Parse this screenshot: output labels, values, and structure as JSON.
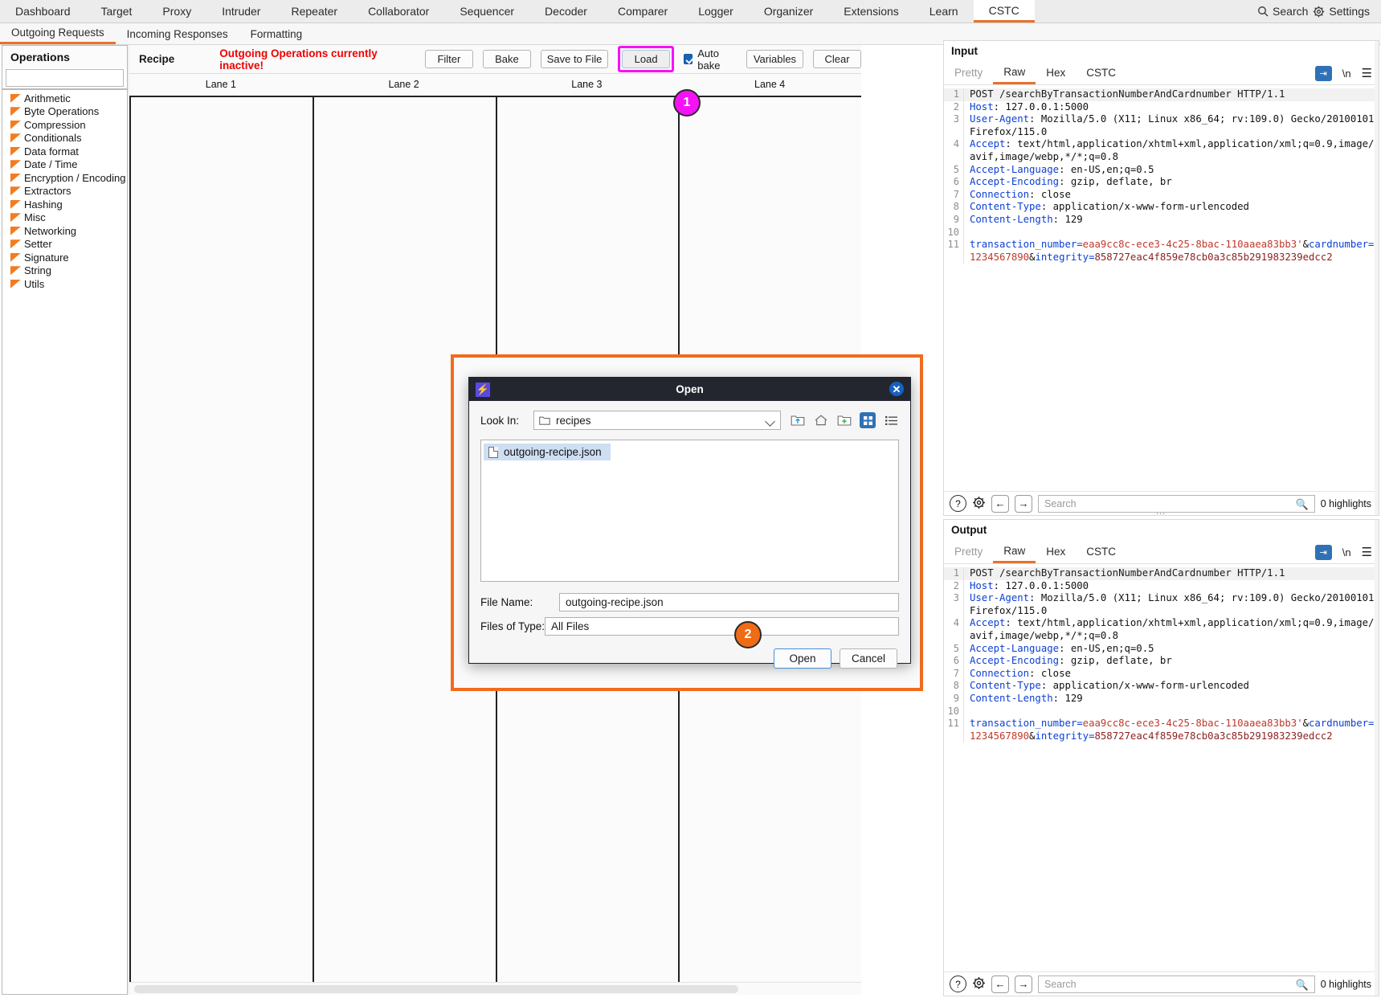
{
  "topnav": {
    "tabs": [
      {
        "label": "Dashboard",
        "active": false
      },
      {
        "label": "Target",
        "active": false
      },
      {
        "label": "Proxy",
        "active": false
      },
      {
        "label": "Intruder",
        "active": false
      },
      {
        "label": "Repeater",
        "active": false
      },
      {
        "label": "Collaborator",
        "active": false
      },
      {
        "label": "Sequencer",
        "active": false
      },
      {
        "label": "Decoder",
        "active": false
      },
      {
        "label": "Comparer",
        "active": false
      },
      {
        "label": "Logger",
        "active": false
      },
      {
        "label": "Organizer",
        "active": false
      },
      {
        "label": "Extensions",
        "active": false
      },
      {
        "label": "Learn",
        "active": false
      },
      {
        "label": "CSTC",
        "active": true
      }
    ],
    "search_label": "Search",
    "settings_label": "Settings"
  },
  "subnav": {
    "tabs": [
      {
        "label": "Outgoing Requests",
        "active": true
      },
      {
        "label": "Incoming Responses",
        "active": false
      },
      {
        "label": "Formatting",
        "active": false
      }
    ]
  },
  "operations": {
    "title": "Operations",
    "search_value": "",
    "items": [
      {
        "label": "Arithmetic"
      },
      {
        "label": "Byte Operations"
      },
      {
        "label": "Compression"
      },
      {
        "label": "Conditionals"
      },
      {
        "label": "Data format"
      },
      {
        "label": "Date / Time"
      },
      {
        "label": "Encryption / Encoding"
      },
      {
        "label": "Extractors"
      },
      {
        "label": "Hashing"
      },
      {
        "label": "Misc"
      },
      {
        "label": "Networking"
      },
      {
        "label": "Setter"
      },
      {
        "label": "Signature"
      },
      {
        "label": "String"
      },
      {
        "label": "Utils"
      }
    ]
  },
  "recipe": {
    "label": "Recipe",
    "warning": "Outgoing Operations currently inactive!",
    "buttons": {
      "filter": "Filter",
      "bake": "Bake",
      "save_to_file": "Save to File",
      "load": "Load",
      "variables": "Variables",
      "clear": "Clear"
    },
    "auto_bake_label": "Auto bake",
    "auto_bake_checked": true,
    "lanes": [
      "Lane 1",
      "Lane 2",
      "Lane 3",
      "Lane 4"
    ]
  },
  "markers": [
    {
      "id": "1",
      "label": "1",
      "color": "#f612f6"
    },
    {
      "id": "2",
      "label": "2",
      "color": "#ef6c14"
    }
  ],
  "highlight_colors": {
    "marker_magenta": "#f612f6",
    "marker_orange": "#ef6c14",
    "dialog_outline": "#f26b1d",
    "accent_orange": "#e8722c",
    "warning_red": "#f10000"
  },
  "dialog": {
    "title": "Open",
    "look_in_label": "Look In:",
    "look_in_value": "recipes",
    "toolbar_icons": [
      {
        "name": "up-folder-icon",
        "selected": false
      },
      {
        "name": "home-icon",
        "selected": false
      },
      {
        "name": "new-folder-icon",
        "selected": false
      },
      {
        "name": "grid-view-icon",
        "selected": true
      },
      {
        "name": "list-view-icon",
        "selected": false
      }
    ],
    "files": [
      {
        "name": "outgoing-recipe.json",
        "selected": true
      }
    ],
    "file_name_label": "File Name:",
    "file_name_value": "outgoing-recipe.json",
    "files_of_type_label": "Files of Type:",
    "files_of_type_value": "All Files",
    "open_button": "Open",
    "cancel_button": "Cancel"
  },
  "input_pane": {
    "title": "Input",
    "tabs": [
      {
        "label": "Pretty",
        "active": false,
        "muted": true
      },
      {
        "label": "Raw",
        "active": true,
        "muted": false
      },
      {
        "label": "Hex",
        "active": false,
        "muted": false
      },
      {
        "label": "CSTC",
        "active": false,
        "muted": false
      }
    ],
    "newline_label": "\\n",
    "lines": [
      {
        "n": "1",
        "type": "request",
        "text": "POST /searchByTransactionNumberAndCardnumber HTTP/1.1"
      },
      {
        "n": "2",
        "type": "header",
        "key": "Host",
        "value": "127.0.0.1:5000"
      },
      {
        "n": "3",
        "type": "header",
        "key": "User-Agent",
        "value": "Mozilla/5.0 (X11; Linux x86_64; rv:109.0) Gecko/20100101 Firefox/115.0"
      },
      {
        "n": "4",
        "type": "header",
        "key": "Accept",
        "value": "text/html,application/xhtml+xml,application/xml;q=0.9,image/avif,image/webp,*/*;q=0.8"
      },
      {
        "n": "5",
        "type": "header",
        "key": "Accept-Language",
        "value": "en-US,en;q=0.5"
      },
      {
        "n": "6",
        "type": "header",
        "key": "Accept-Encoding",
        "value": "gzip, deflate, br"
      },
      {
        "n": "7",
        "type": "header",
        "key": "Connection",
        "value": "close"
      },
      {
        "n": "8",
        "type": "header",
        "key": "Content-Type",
        "value": "application/x-www-form-urlencoded"
      },
      {
        "n": "9",
        "type": "header",
        "key": "Content-Length",
        "value": "129"
      },
      {
        "n": "10",
        "type": "blank",
        "text": ""
      },
      {
        "n": "11",
        "type": "body",
        "params": [
          {
            "key": "transaction_number",
            "value": "eaa9cc8c-ece3-4c25-8bac-110aaea83bb3'",
            "sep": "&"
          },
          {
            "key": "cardnumber",
            "value": "1234567890",
            "sep": "&"
          },
          {
            "key": "integrity",
            "value": "858727eac4f859e78cb0a3c85b291983239edcc2",
            "sep": ""
          }
        ]
      }
    ],
    "find": {
      "search_placeholder": "Search",
      "highlights": "0 highlights"
    }
  },
  "output_pane": {
    "title": "Output",
    "tabs": [
      {
        "label": "Pretty",
        "active": false,
        "muted": true
      },
      {
        "label": "Raw",
        "active": true,
        "muted": false
      },
      {
        "label": "Hex",
        "active": false,
        "muted": false
      },
      {
        "label": "CSTC",
        "active": false,
        "muted": false
      }
    ],
    "newline_label": "\\n",
    "lines": [
      {
        "n": "1",
        "type": "request",
        "text": "POST /searchByTransactionNumberAndCardnumber HTTP/1.1"
      },
      {
        "n": "2",
        "type": "header",
        "key": "Host",
        "value": "127.0.0.1:5000"
      },
      {
        "n": "3",
        "type": "header",
        "key": "User-Agent",
        "value": "Mozilla/5.0 (X11; Linux x86_64; rv:109.0) Gecko/20100101 Firefox/115.0"
      },
      {
        "n": "4",
        "type": "header",
        "key": "Accept",
        "value": "text/html,application/xhtml+xml,application/xml;q=0.9,image/avif,image/webp,*/*;q=0.8"
      },
      {
        "n": "5",
        "type": "header",
        "key": "Accept-Language",
        "value": "en-US,en;q=0.5"
      },
      {
        "n": "6",
        "type": "header",
        "key": "Accept-Encoding",
        "value": "gzip, deflate, br"
      },
      {
        "n": "7",
        "type": "header",
        "key": "Connection",
        "value": "close"
      },
      {
        "n": "8",
        "type": "header",
        "key": "Content-Type",
        "value": "application/x-www-form-urlencoded"
      },
      {
        "n": "9",
        "type": "header",
        "key": "Content-Length",
        "value": "129"
      },
      {
        "n": "10",
        "type": "blank",
        "text": ""
      },
      {
        "n": "11",
        "type": "body",
        "params": [
          {
            "key": "transaction_number",
            "value": "eaa9cc8c-ece3-4c25-8bac-110aaea83bb3'",
            "sep": "&"
          },
          {
            "key": "cardnumber",
            "value": "1234567890",
            "sep": "&"
          },
          {
            "key": "integrity",
            "value": "858727eac4f859e78cb0a3c85b291983239edcc2",
            "sep": ""
          }
        ]
      }
    ],
    "find": {
      "search_placeholder": "Search",
      "highlights": "0 highlights"
    }
  }
}
